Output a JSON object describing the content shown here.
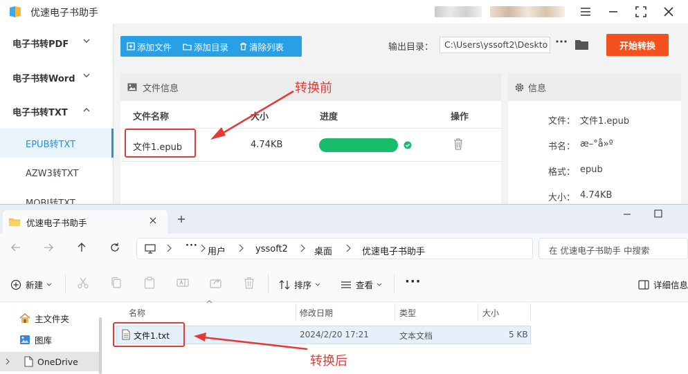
{
  "app": {
    "title": "优速电子书助手",
    "sidebar": {
      "groups": [
        {
          "label": "电子书转PDF",
          "expanded": false
        },
        {
          "label": "电子书转Word",
          "expanded": false
        },
        {
          "label": "电子书转TXT",
          "expanded": true
        }
      ],
      "items": [
        {
          "label": "EPUB转TXT",
          "active": true
        },
        {
          "label": "AZW3转TXT",
          "active": false
        },
        {
          "label": "MOBI转TXT",
          "active": false
        }
      ]
    },
    "toolbar": {
      "add_file": "添加文件",
      "add_folder": "添加目录",
      "clear_list": "清除列表",
      "output_label": "输出目录：",
      "output_path": "C:\\Users\\yssoft2\\Deskto",
      "start": "开始转换"
    },
    "file_panel": {
      "title": "文件信息",
      "headers": {
        "name": "文件名称",
        "size": "大小",
        "progress": "进度",
        "action": "操作"
      },
      "row": {
        "name": "文件1.epub",
        "size": "4.74KB",
        "progress": 1.0
      }
    },
    "info_panel": {
      "title": "信息",
      "rows": [
        {
          "label": "文件：",
          "value": "文件1.epub"
        },
        {
          "label": "书名：",
          "value": "æ–°å»º"
        },
        {
          "label": "格式：",
          "value": "epub"
        },
        {
          "label": "大小：",
          "value": "4.74KB"
        }
      ]
    }
  },
  "annotations": {
    "before": "转换前",
    "after": "转换后",
    "color": "#e53935"
  },
  "explorer": {
    "tab_title": "优速电子书助手",
    "breadcrumb": [
      "用户",
      "yssoft2",
      "桌面",
      "优速电子书助手"
    ],
    "search_placeholder": "在 优速电子书助手 中搜索",
    "commands": {
      "new": "新建",
      "sort": "排序",
      "view": "查看",
      "details": "详细信息"
    },
    "nav_items": [
      {
        "label": "主文件夹",
        "icon": "home-icon"
      },
      {
        "label": "图库",
        "icon": "gallery-icon"
      },
      {
        "label": "OneDrive",
        "icon": "cloud-icon"
      }
    ],
    "columns": {
      "name": "名称",
      "modified": "修改日期",
      "type": "类型",
      "size": "大小"
    },
    "files": [
      {
        "name": "文件1.txt",
        "modified": "2024/2/20 17:21",
        "type": "文本文档",
        "size": "5 KB"
      }
    ]
  },
  "colors": {
    "accent": "#29a0e6",
    "start_button": "#f4511e",
    "progress": "#18bd6c"
  }
}
